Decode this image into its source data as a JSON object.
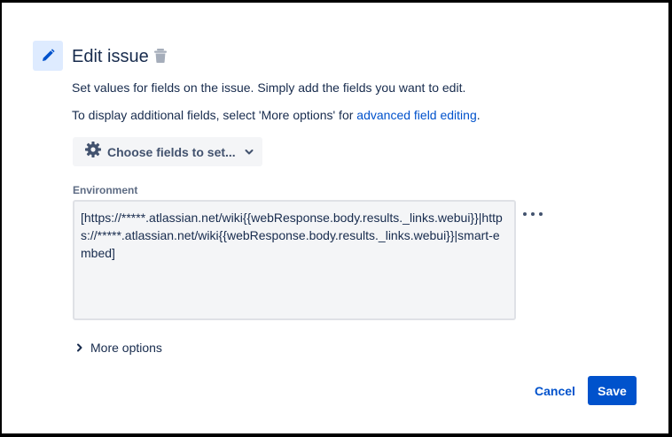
{
  "dialog": {
    "title": "Edit issue",
    "header_icon": "pencil-icon",
    "delete_icon": "trash-icon",
    "description_line1": "Set values for fields on the issue. Simply add the fields you want to edit.",
    "description_line2_prefix": "To display additional fields, select 'More options' for ",
    "description_line2_link": "advanced field editing",
    "description_line2_suffix": "."
  },
  "choose_fields": {
    "label": "Choose fields to set...",
    "icon": "gear-icon"
  },
  "environment": {
    "label": "Environment",
    "value": "[https://*****.atlassian.net/wiki{{webResponse.body.results._links.webui}}|https://*****.atlassian.net/wiki{{webResponse.body.results._links.webui}}|smart-embed]"
  },
  "more_options": {
    "label": "More options"
  },
  "footer": {
    "cancel_label": "Cancel",
    "save_label": "Save"
  },
  "colors": {
    "primary": "#0052cc",
    "text": "#172b4d",
    "subtle": "#42526e",
    "field_bg": "#f4f5f7",
    "icon_bg": "#deebff"
  }
}
